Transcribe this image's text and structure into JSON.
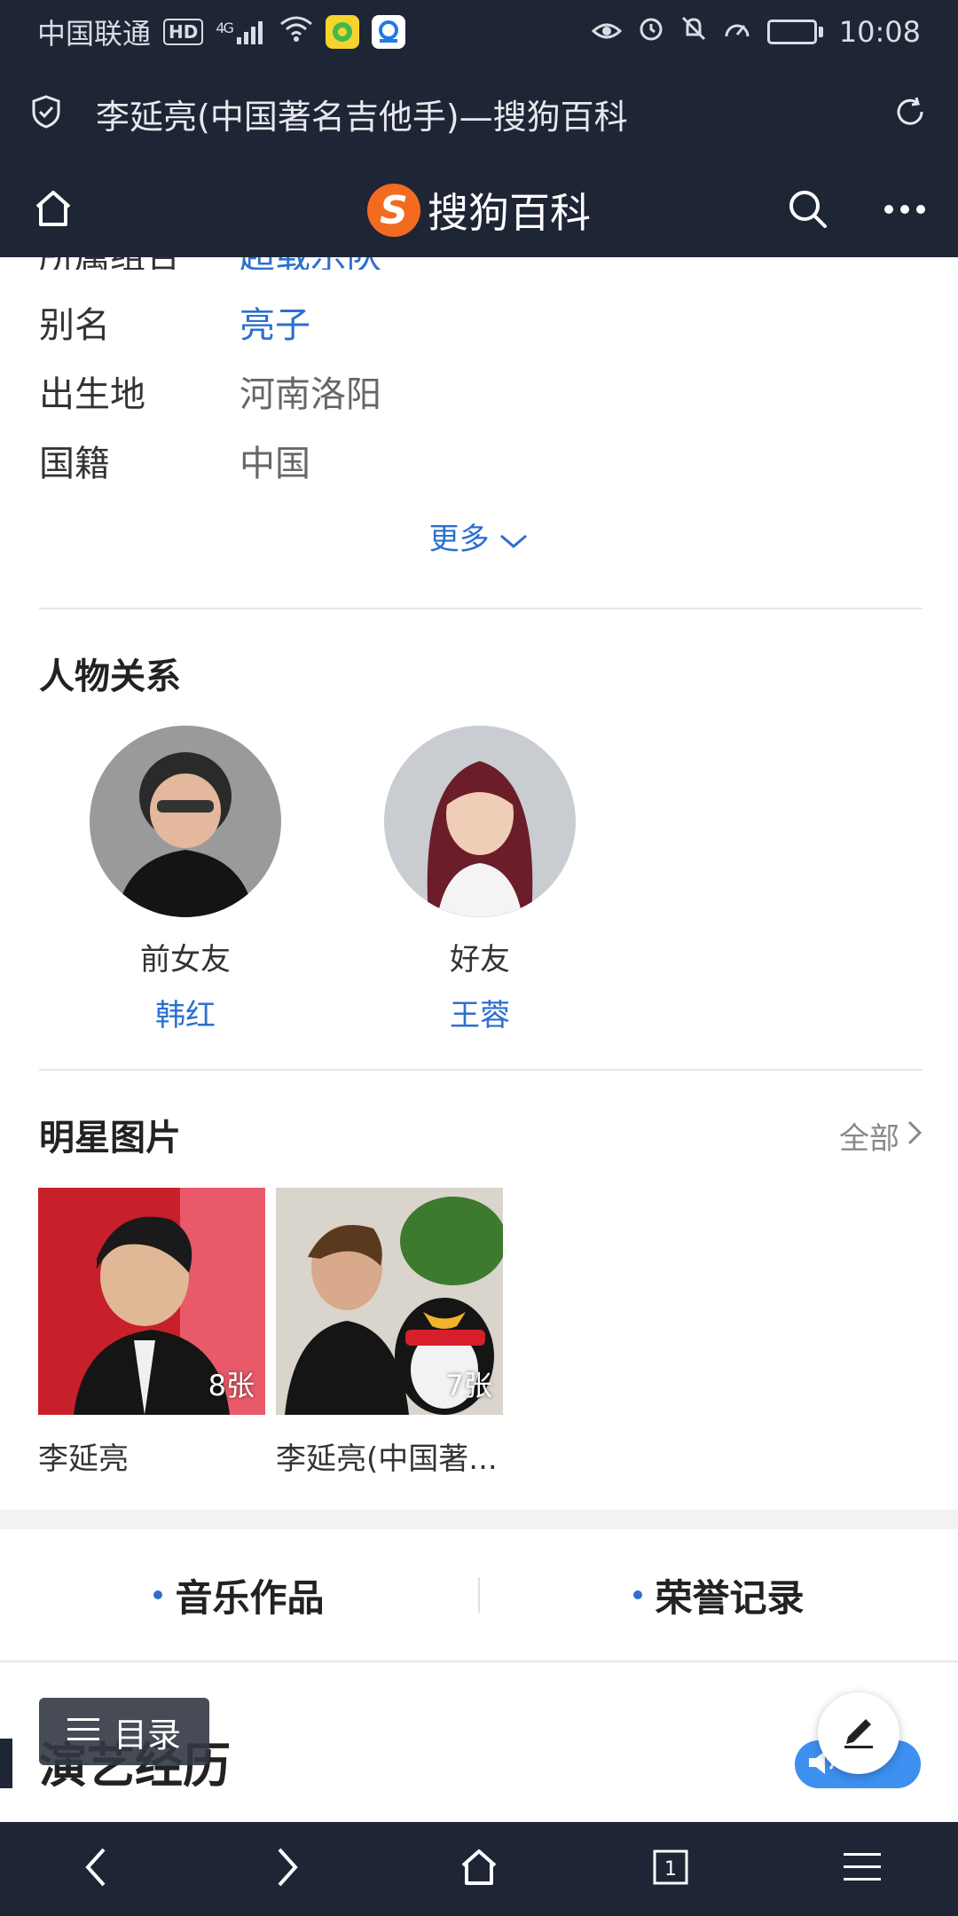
{
  "status_bar": {
    "carrier": "中国联通",
    "hd": "HD",
    "network": "4G",
    "battery": "11",
    "battery_level": 0.11,
    "time": "10:08"
  },
  "title_bar": {
    "title": "李延亮(中国著名吉他手)—搜狗百科",
    "shield_icon": "shield-check-icon",
    "refresh_icon": "refresh-icon"
  },
  "nav_bar": {
    "brand_logo": "S",
    "brand_name": "搜狗百科",
    "home_icon": "home-icon",
    "search_icon": "search-icon",
    "more_icon": "more-dots-icon"
  },
  "info": {
    "cut_row": {
      "key": "所属组合",
      "value": "超载乐队"
    },
    "rows": [
      {
        "key": "别名",
        "value": "亮子",
        "link": true
      },
      {
        "key": "出生地",
        "value": "河南洛阳",
        "link": false
      },
      {
        "key": "国籍",
        "value": "中国",
        "link": false
      }
    ],
    "more_label": "更多"
  },
  "relations": {
    "title": "人物关系",
    "people": [
      {
        "relation": "前女友",
        "name": "韩红"
      },
      {
        "relation": "好友",
        "name": "王蓉"
      }
    ]
  },
  "photos": {
    "title": "明星图片",
    "all_label": "全部",
    "albums": [
      {
        "caption": "李延亮",
        "count": "8张"
      },
      {
        "caption": "李延亮(中国著...",
        "count": "7张"
      }
    ]
  },
  "tabs": [
    {
      "label": "音乐作品"
    },
    {
      "label": "荣誉记录"
    }
  ],
  "section": {
    "title": "演艺经历",
    "toc_label": "目录"
  },
  "colors": {
    "bar_bg": "#1e2535",
    "link": "#2c6fcf",
    "brand": "#f36b21"
  }
}
